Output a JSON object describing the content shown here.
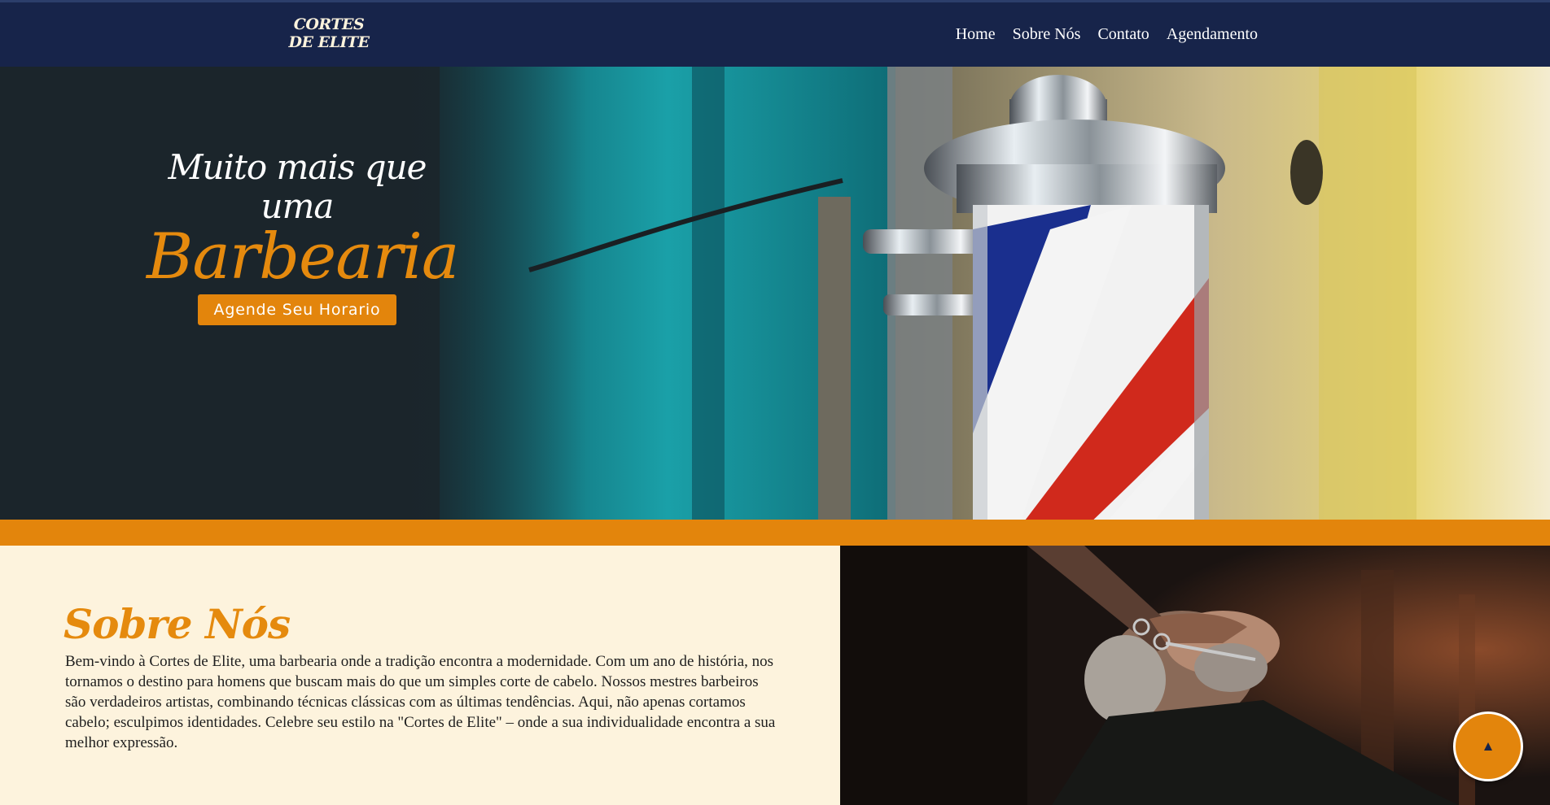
{
  "brand": {
    "logo_text": "CORTES DE ELITE"
  },
  "nav": {
    "items": [
      {
        "label": "Home"
      },
      {
        "label": "Sobre Nós"
      },
      {
        "label": "Contato"
      },
      {
        "label": "Agendamento"
      }
    ]
  },
  "hero": {
    "line1": "Muito mais que uma",
    "line2": "Barbearia",
    "cta_label": "Agende Seu Horario"
  },
  "about": {
    "title": "Sobre Nós",
    "body": "Bem-vindo à Cortes de Elite, uma barbearia onde a tradição encontra a modernidade. Com um ano de história, nos tornamos o destino para homens que buscam mais do que um simples corte de cabelo. Nossos mestres barbeiros são verdadeiros artistas, combinando técnicas clássicas com as últimas tendências. Aqui, não apenas cortamos cabelo; esculpimos identidades. Celebre seu estilo na \"Cortes de Elite\" – onde a sua individualidade encontra a sua melhor expressão."
  },
  "colors": {
    "navbar": "#17244a",
    "accent": "#e3850c",
    "cream": "#fdf3dd"
  },
  "icons": {
    "scroll_top": "arrow-up-icon"
  }
}
